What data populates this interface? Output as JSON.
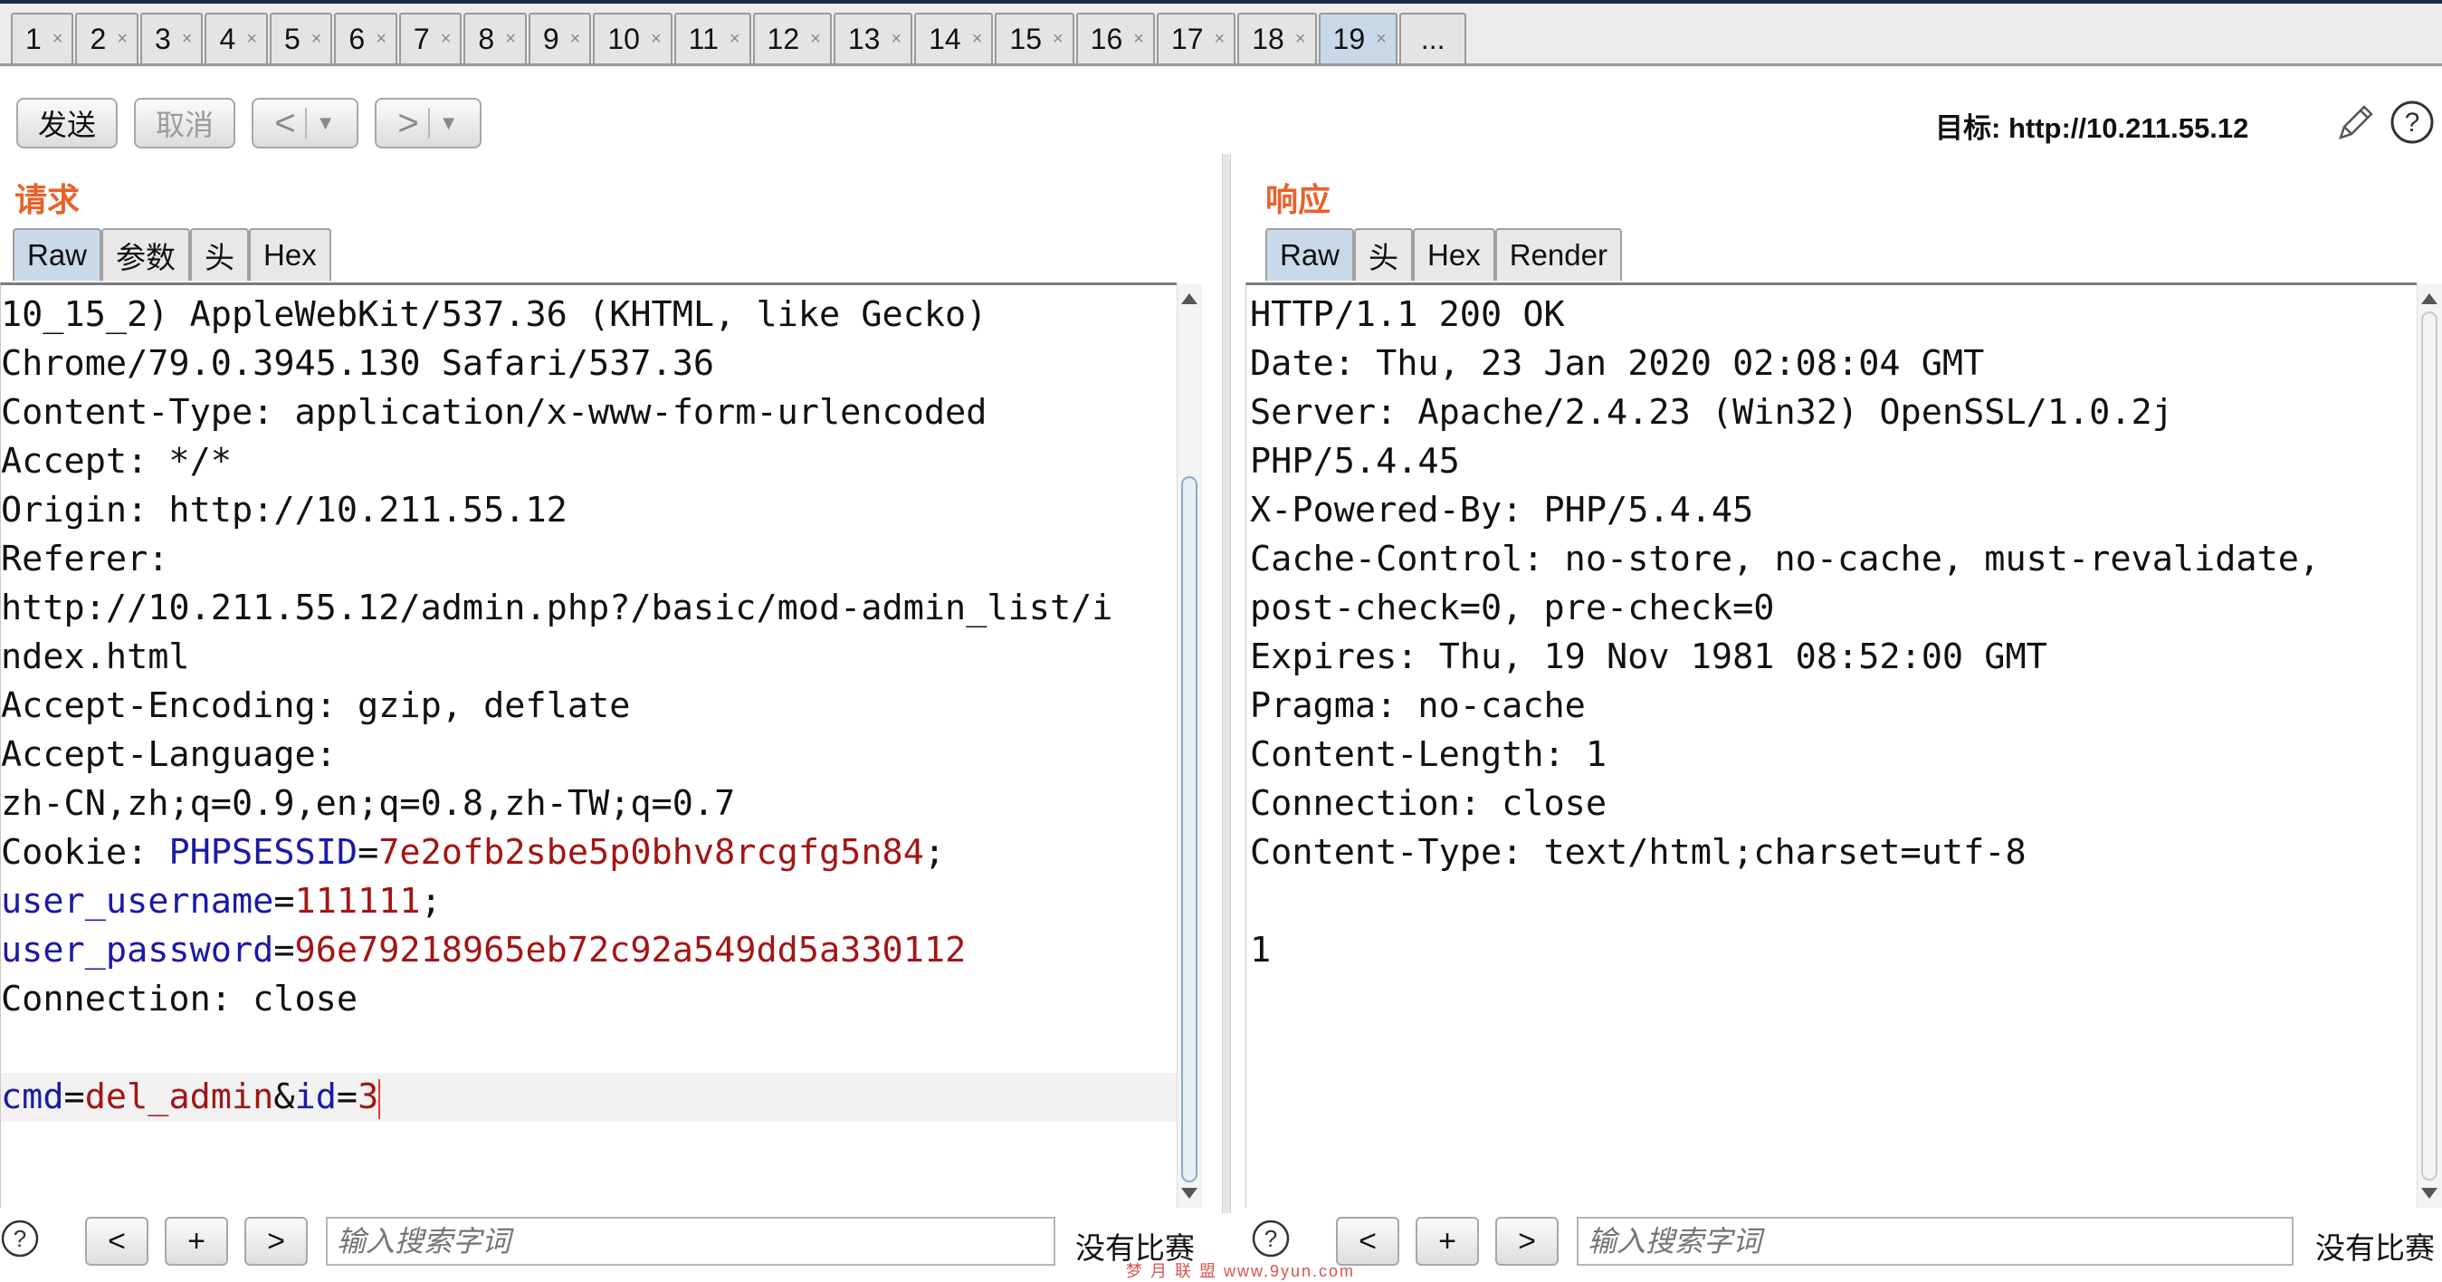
{
  "tabs": [
    "1",
    "2",
    "3",
    "4",
    "5",
    "6",
    "7",
    "8",
    "9",
    "10",
    "11",
    "12",
    "13",
    "14",
    "15",
    "16",
    "17",
    "18",
    "19"
  ],
  "tab_more_label": "...",
  "tab_close_glyph": "×",
  "active_tab": "19",
  "toolbar": {
    "send_label": "发送",
    "cancel_label": "取消",
    "back_label": "<",
    "forward_label": ">",
    "dropdown_glyph": "▼",
    "target_prefix": "目标:",
    "target_url": "http://10.211.55.12"
  },
  "request": {
    "title": "请求",
    "tabs": [
      "Raw",
      "参数",
      "头",
      "Hex"
    ],
    "active_tab": "Raw",
    "lines": [
      [
        {
          "t": "10_15_2) AppleWebKit/537.36 (KHTML, like Gecko)",
          "c": ""
        }
      ],
      [
        {
          "t": "Chrome/79.0.3945.130 Safari/537.36",
          "c": ""
        }
      ],
      [
        {
          "t": "Content-Type: application/x-www-form-urlencoded",
          "c": ""
        }
      ],
      [
        {
          "t": "Accept: */*",
          "c": ""
        }
      ],
      [
        {
          "t": "Origin: http://10.211.55.12",
          "c": ""
        }
      ],
      [
        {
          "t": "Referer:",
          "c": ""
        }
      ],
      [
        {
          "t": "http://10.211.55.12/admin.php?/basic/mod-admin_list/i",
          "c": ""
        }
      ],
      [
        {
          "t": "ndex.html",
          "c": ""
        }
      ],
      [
        {
          "t": "Accept-Encoding: gzip, deflate",
          "c": ""
        }
      ],
      [
        {
          "t": "Accept-Language:",
          "c": ""
        }
      ],
      [
        {
          "t": "zh-CN,zh;q=0.9,en;q=0.8,zh-TW;q=0.7",
          "c": ""
        }
      ],
      [
        {
          "t": "Cookie: ",
          "c": ""
        },
        {
          "t": "PHPSESSID",
          "c": "k"
        },
        {
          "t": "=",
          "c": ""
        },
        {
          "t": "7e2ofb2sbe5p0bhv8rcgfg5n84",
          "c": "v"
        },
        {
          "t": ";",
          "c": ""
        }
      ],
      [
        {
          "t": "user_username",
          "c": "k"
        },
        {
          "t": "=",
          "c": ""
        },
        {
          "t": "111111",
          "c": "v"
        },
        {
          "t": ";",
          "c": ""
        }
      ],
      [
        {
          "t": "user_password",
          "c": "k"
        },
        {
          "t": "=",
          "c": ""
        },
        {
          "t": "96e79218965eb72c92a549dd5a330112",
          "c": "v"
        }
      ],
      [
        {
          "t": "Connection: close",
          "c": ""
        }
      ],
      [
        {
          "t": "",
          "c": ""
        }
      ],
      [
        {
          "t": "cmd",
          "c": "k"
        },
        {
          "t": "=",
          "c": ""
        },
        {
          "t": "del_admin",
          "c": "v"
        },
        {
          "t": "&",
          "c": ""
        },
        {
          "t": "id",
          "c": "k"
        },
        {
          "t": "=",
          "c": ""
        },
        {
          "t": "3",
          "c": "v"
        }
      ]
    ]
  },
  "response": {
    "title": "响应",
    "tabs": [
      "Raw",
      "头",
      "Hex",
      "Render"
    ],
    "active_tab": "Raw",
    "lines": [
      "HTTP/1.1 200 OK",
      "Date: Thu, 23 Jan 2020 02:08:04 GMT",
      "Server: Apache/2.4.23 (Win32) OpenSSL/1.0.2j",
      "PHP/5.4.45",
      "X-Powered-By: PHP/5.4.45",
      "Cache-Control: no-store, no-cache, must-revalidate,",
      "post-check=0, pre-check=0",
      "Expires: Thu, 19 Nov 1981 08:52:00 GMT",
      "Pragma: no-cache",
      "Content-Length: 1",
      "Connection: close",
      "Content-Type: text/html;charset=utf-8",
      "",
      "1"
    ]
  },
  "search": {
    "help_label": "?",
    "prev_label": "<",
    "add_label": "+",
    "next_label": ">",
    "placeholder": "输入搜索字词",
    "no_match": "没有比赛"
  },
  "watermark": "梦 月 联 盟   www.9yun.com"
}
